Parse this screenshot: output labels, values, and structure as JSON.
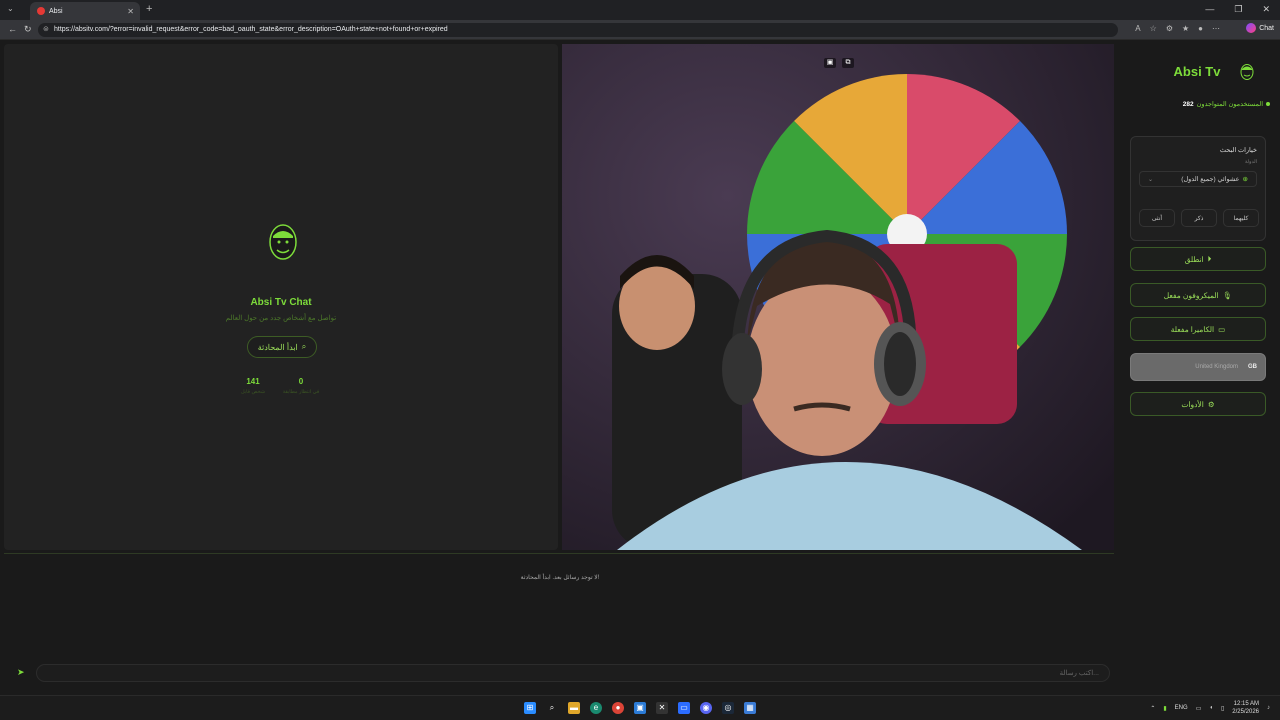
{
  "browser": {
    "tab_title": "Absi",
    "url": "https://absitv.com/?error=invalid_request&error_code=bad_oauth_state&error_description=OAuth+state+not+found+or+expired",
    "chat_button": "Chat"
  },
  "left": {
    "title": "Absi Tv Chat",
    "subtitle": "تواصل مع أشخاص جدد من حول العالم",
    "start_button": "ابدأ المحادثة",
    "stats": [
      {
        "value": "141",
        "label": "شخص قابل"
      },
      {
        "value": "0",
        "label": "في انتظار مطابقة"
      }
    ]
  },
  "sidebar": {
    "brand": "Absi Tv",
    "online_label": "المستخدمون المتواجدون",
    "online_count": "282",
    "search_title": "خيارات البحث",
    "country_label": "الدولة",
    "country_value": "عشوائي (جميع الدول)",
    "gender_options": [
      "كليهما",
      "ذكر",
      "أنثى"
    ],
    "start_btn": "انطلق",
    "mic_btn": "الميكروفون مفعل",
    "cam_btn": "الكاميرا مفعلة",
    "location_country": "United Kingdom",
    "location_code": "GB",
    "tools_btn": "الأدوات"
  },
  "chat": {
    "empty_text": "لا توجد رسائل بعد. ابدأ المحادثة!",
    "input_placeholder": "اكتب رسالة..."
  },
  "taskbar": {
    "lang": "ENG",
    "time": "12:15 AM",
    "date": "2/25/2026"
  },
  "colors": {
    "accent": "#7ddc3a"
  }
}
